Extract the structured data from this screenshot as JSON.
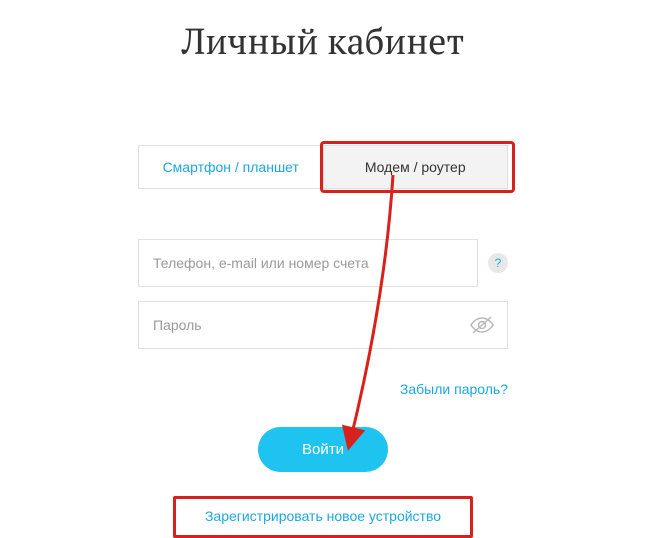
{
  "title": "Личный кабинет",
  "tabs": {
    "smartphone": "Смартфон / планшет",
    "modem": "Модем / роутер"
  },
  "login_input": {
    "placeholder": "Телефон, e-mail или номер счета"
  },
  "password_input": {
    "placeholder": "Пароль"
  },
  "help_symbol": "?",
  "forgot_password": "Забыли пароль?",
  "login_button": "Войти",
  "register_link": "Зарегистрировать новое устройство"
}
